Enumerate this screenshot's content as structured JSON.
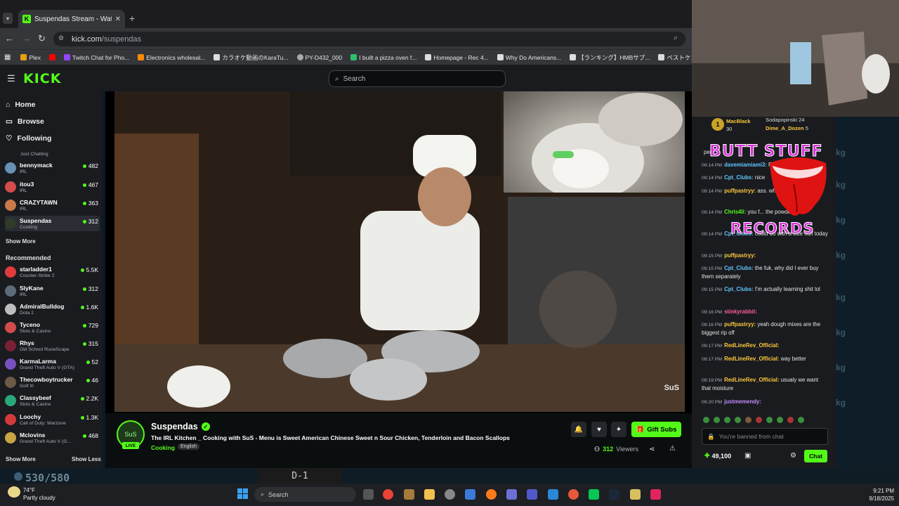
{
  "browser": {
    "tab_title": "Suspendas Stream - Watch Live",
    "url_host": "kick.com",
    "url_path": "/suspendas",
    "bookmarks": [
      {
        "label": "Plex",
        "color": "#e5a00d"
      },
      {
        "label": "",
        "color": "#ff0000"
      },
      {
        "label": "Twitch Chat for Pho...",
        "color": "#9146ff"
      },
      {
        "label": "Electronics wholesal...",
        "color": "#ff8a00"
      },
      {
        "label": "カラオケ動画のKaraTu...",
        "color": "#dddddd"
      },
      {
        "label": "PY-D432_000",
        "color": "#aaaaaa"
      },
      {
        "label": "I built a pizza oven f...",
        "color": "#2dbe6c"
      },
      {
        "label": "Homepage - Rec 4...",
        "color": "#dddddd"
      },
      {
        "label": "Why Do Americans...",
        "color": "#dddddd"
      },
      {
        "label": "【ランキング】HMBサプ...",
        "color": "#dddddd"
      },
      {
        "label": "ベストケンコー | 公式...",
        "color": "#dddddd"
      }
    ]
  },
  "kick": {
    "logo": "KICK",
    "search_placeholder": "Search",
    "nav": {
      "home": "Home",
      "browse": "Browse",
      "following": "Following"
    },
    "following_partial_cat": "Just Chatting",
    "following": [
      {
        "name": "bennymack",
        "category": "IRL",
        "viewers": "482",
        "color": "#6a8fb5"
      },
      {
        "name": "itou3",
        "category": "IRL",
        "viewers": "467",
        "color": "#d34b4b"
      },
      {
        "name": "CRAZYTAWN",
        "category": "IRL",
        "viewers": "363",
        "color": "#c87a4a"
      },
      {
        "name": "Suspendas",
        "category": "Cooking",
        "viewers": "312",
        "color": "#2f3a2a"
      }
    ],
    "show_more": "Show More",
    "recommended_heading": "Recommended",
    "recommended": [
      {
        "name": "starladder1",
        "category": "Counter-Strike 2",
        "viewers": "5.5K",
        "color": "#e23b3b"
      },
      {
        "name": "SlyKane",
        "category": "IRL",
        "viewers": "312",
        "color": "#5b6b7a"
      },
      {
        "name": "AdmiralBulldog",
        "category": "Dota 2",
        "viewers": "1.6K",
        "color": "#bdbdbd"
      },
      {
        "name": "Tyceno",
        "category": "Slots & Casino",
        "viewers": "729",
        "color": "#d14b4b"
      },
      {
        "name": "Rhys",
        "category": "Old School RuneScape",
        "viewers": "315",
        "color": "#7a2035"
      },
      {
        "name": "KarmaLarma",
        "category": "Grand Theft Auto V (GTA)",
        "viewers": "52",
        "color": "#7a4fbf"
      },
      {
        "name": "Thecowboytrucker",
        "category": "Golf It!",
        "viewers": "46",
        "color": "#6b5a45"
      },
      {
        "name": "Classybeef",
        "category": "Slots & Casino",
        "viewers": "2.2K",
        "color": "#2aa87b"
      },
      {
        "name": "Loochy",
        "category": "Call of Duty: Warzone",
        "viewers": "1.3K",
        "color": "#d43a3a"
      },
      {
        "name": "Mclovins",
        "category": "Grand Theft Auto V (G...",
        "viewers": "468",
        "color": "#c7a544"
      }
    ],
    "show_more_bottom": "Show More",
    "show_less": "Show Less"
  },
  "stream": {
    "streamer": "Suspendas",
    "live_badge": "LIVE",
    "title": "The IRL Kitchen _ Cooking with SuS - Menu is Sweet American Chinese Sweet n Sour Chicken, Tenderloin and Bacon Scallops",
    "category": "Cooking",
    "tag": "English",
    "gift_subs": "Gift Subs",
    "viewers": "312",
    "viewers_label": "Viewers",
    "video_watermark": "SuS"
  },
  "chat": {
    "leaderboard": [
      {
        "name": "MacBlack",
        "count": "30"
      },
      {
        "name": "Sodapopinski",
        "count": "24"
      },
      {
        "name": "Dime_A_Dozen",
        "count": "5"
      }
    ],
    "messages": [
      {
        "time": "",
        "user": "",
        "text": "per",
        "cls": ""
      },
      {
        "time": "09:14 PM",
        "user": "davemiamiami3:",
        "text": "Fluff",
        "cls": "u2"
      },
      {
        "time": "09:14 PM",
        "user": "Cpt_Clubs:",
        "text": "nice",
        "cls": "u2"
      },
      {
        "time": "09:14 PM",
        "user": "puffpastryy:",
        "text": "ass. why not just tell e",
        "cls": "u3"
      },
      {
        "time": "09:14 PM",
        "user": "Chris4li:",
        "text": "you f... the powder",
        "cls": "u1"
      },
      {
        "time": "09:14 PM",
        "user": "Cpt_Clubs:",
        "text": "could do with a little fluff today",
        "cls": "u2"
      },
      {
        "time": "09:15 PM",
        "user": "puffpastryy:",
        "text": "",
        "cls": "u3"
      },
      {
        "time": "09:15 PM",
        "user": "Cpt_Clubs:",
        "text": "the fuk, why did I ever buy them separately",
        "cls": "u2"
      },
      {
        "time": "09:15 PM",
        "user": "Cpt_Clubs:",
        "text": "I'm actually learning shit lol",
        "cls": "u2"
      },
      {
        "time": "09:16 PM",
        "user": "stinkyrabbit:",
        "text": "",
        "cls": "u4"
      },
      {
        "time": "09:16 PM",
        "user": "puffpastryy:",
        "text": "yeah dough mixes are the biggest rip off",
        "cls": "u3"
      },
      {
        "time": "09:17 PM",
        "user": "RedLineRev_Official:",
        "text": "",
        "cls": "u3"
      },
      {
        "time": "09:17 PM",
        "user": "RedLineRev_Official:",
        "text": "way better",
        "cls": "u3"
      },
      {
        "time": "09:19 PM",
        "user": "RedLineRev_Official:",
        "text": "usualy we want that moisture",
        "cls": "u3"
      },
      {
        "time": "09:20 PM",
        "user": "justmemendy:",
        "text": "",
        "cls": "u5"
      }
    ],
    "input_placeholder": "You're banned from chat",
    "points": "49,100",
    "chat_button": "Chat"
  },
  "overlay": {
    "line1": "BUTT STUFF",
    "line2": "RECORDS",
    "side_label": "kg",
    "score": "530/580",
    "game_label": "D-1"
  },
  "taskbar": {
    "temp": "74°F",
    "condition": "Partly cloudy",
    "search": "Search",
    "time": "9:21 PM",
    "date": "9/18/2025"
  }
}
